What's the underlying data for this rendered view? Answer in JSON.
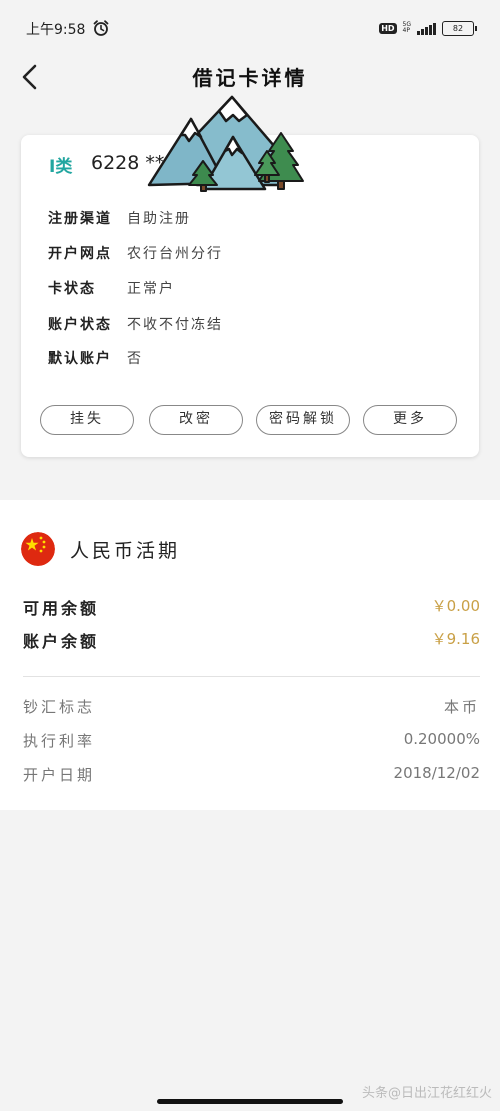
{
  "status_bar": {
    "time": "上午9:58",
    "hd": "HD",
    "net_top": "5G",
    "net_bottom": "4P",
    "battery": "82"
  },
  "header": {
    "title": "借记卡详情"
  },
  "card": {
    "type": "I类",
    "number": "6228 **",
    "rows": [
      {
        "label": "注册渠道",
        "value": "自助注册"
      },
      {
        "label": "开户网点",
        "value": "农行台州分行"
      },
      {
        "label": "卡状态",
        "value": "正常户"
      },
      {
        "label": "账户状态",
        "value": "不收不付冻结"
      },
      {
        "label": "默认账户",
        "value": "否"
      }
    ],
    "buttons": {
      "report_loss": "挂失",
      "change_pin": "改密",
      "unlock_pin": "密码解锁",
      "more": "更多"
    }
  },
  "account": {
    "title": "人民币活期",
    "available_label": "可用余额",
    "available_value": "￥0.00",
    "balance_label": "账户余额",
    "balance_value": "￥9.16",
    "meta": [
      {
        "label": "钞汇标志",
        "value": "本币"
      },
      {
        "label": "执行利率",
        "value": "0.20000%"
      },
      {
        "label": "开户日期",
        "value": "2018/12/02"
      }
    ]
  },
  "watermark": "头条@日出江花红红火",
  "colors": {
    "accent": "#22a6a0",
    "amount": "#c9a046",
    "background": "#f3f3f3"
  },
  "icons": {
    "back": "chevron-left-icon",
    "alarm": "alarm-clock-icon",
    "flag": "china-flag-icon",
    "sticker": "mountain-sticker"
  }
}
